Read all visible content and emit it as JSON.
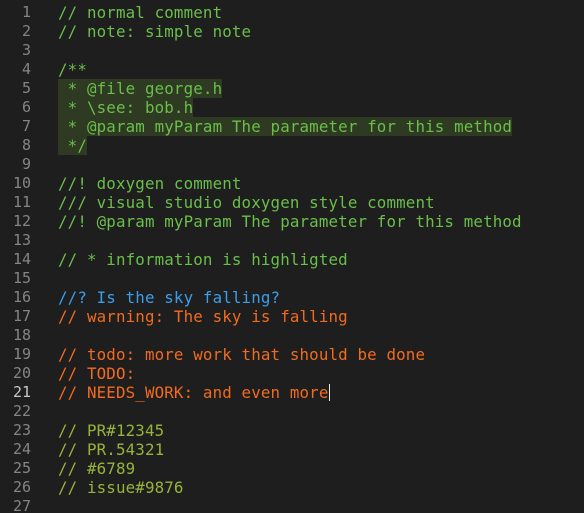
{
  "colors": {
    "background": "#1e1e1e",
    "line_number": "#858585",
    "line_number_active": "#c6c6c6",
    "comment_green": "#6abf4b",
    "question_blue": "#3c9ee8",
    "alert_orange": "#f26b1f",
    "reference_olive": "#98b33a",
    "doc_block_background": "#2f3a22"
  },
  "lines": [
    {
      "num": "1",
      "text": "// normal comment",
      "color": "#6abf4b"
    },
    {
      "num": "2",
      "text": "// note: simple note",
      "color": "#6abf4b"
    },
    {
      "num": "3",
      "text": "",
      "color": "#6abf4b"
    },
    {
      "num": "4",
      "text": "/**",
      "color": "#6abf4b"
    },
    {
      "num": "5",
      "text": " * @file george.h",
      "color": "#6abf4b",
      "highlight": true
    },
    {
      "num": "6",
      "text": " * \\see: bob.h",
      "color": "#6abf4b",
      "highlight": true
    },
    {
      "num": "7",
      "text": " * @param myParam The parameter for this method",
      "color": "#6abf4b",
      "highlight": true
    },
    {
      "num": "8",
      "text": " */",
      "color": "#6abf4b",
      "highlight": true
    },
    {
      "num": "9",
      "text": "",
      "color": "#6abf4b"
    },
    {
      "num": "10",
      "text": "//! doxygen comment",
      "color": "#6abf4b"
    },
    {
      "num": "11",
      "text": "/// visual studio doxygen style comment",
      "color": "#6abf4b"
    },
    {
      "num": "12",
      "text": "//! @param myParam The parameter for this method",
      "color": "#6abf4b"
    },
    {
      "num": "13",
      "text": "",
      "color": "#6abf4b"
    },
    {
      "num": "14",
      "text": "// * information is highligted",
      "color": "#6abf4b"
    },
    {
      "num": "15",
      "text": "",
      "color": "#6abf4b"
    },
    {
      "num": "16",
      "text": "//? Is the sky falling?",
      "color": "#3c9ee8"
    },
    {
      "num": "17",
      "text": "// warning: The sky is falling",
      "color": "#f26b1f"
    },
    {
      "num": "18",
      "text": "",
      "color": "#6abf4b"
    },
    {
      "num": "19",
      "text": "// todo: more work that should be done",
      "color": "#f26b1f"
    },
    {
      "num": "20",
      "text": "// TODO:",
      "color": "#f26b1f"
    },
    {
      "num": "21",
      "text": "// NEEDS_WORK: and even more",
      "color": "#f26b1f",
      "active": true
    },
    {
      "num": "22",
      "text": "",
      "color": "#6abf4b"
    },
    {
      "num": "23",
      "text": "// PR#12345",
      "color": "#98b33a"
    },
    {
      "num": "24",
      "text": "// PR.54321",
      "color": "#98b33a"
    },
    {
      "num": "25",
      "text": "// #6789",
      "color": "#98b33a"
    },
    {
      "num": "26",
      "text": "// issue#9876",
      "color": "#98b33a"
    },
    {
      "num": "27",
      "text": "",
      "color": "#6abf4b"
    }
  ]
}
